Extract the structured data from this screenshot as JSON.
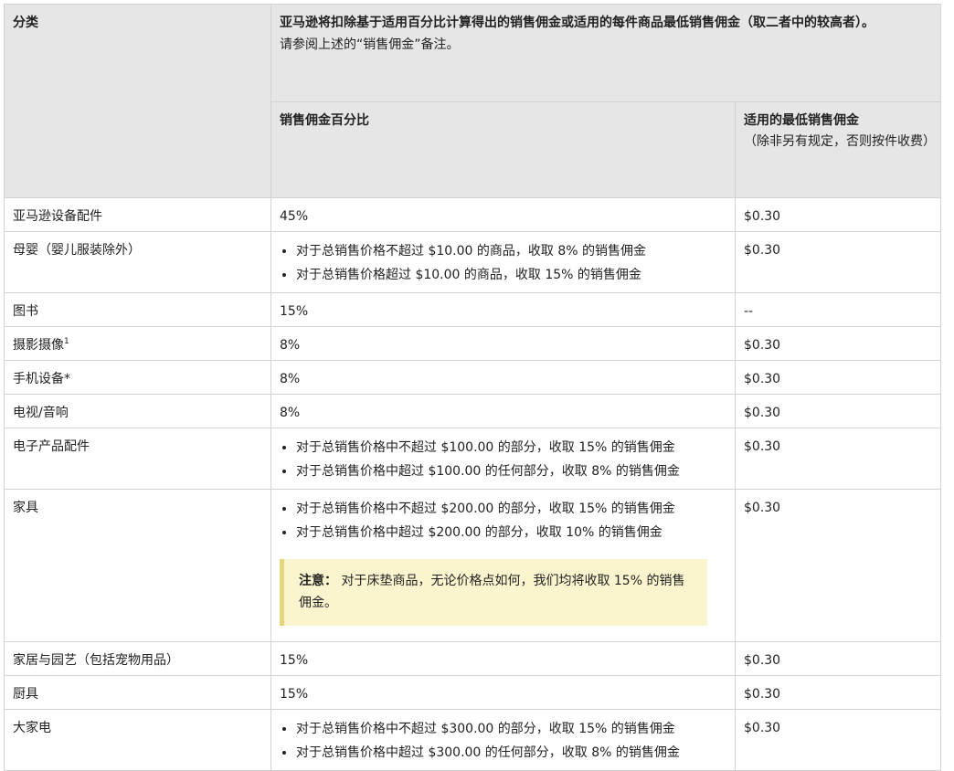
{
  "header": {
    "category_label": "分类",
    "intro_bold": "亚马逊将扣除基于适用百分比计算得出的销售佣金或适用的每件商品最低销售佣金（取二者中的较高者）。",
    "intro_note": "请参阅上述的“销售佣金”备注。",
    "percent_label": "销售佣金百分比",
    "min_label": "适用的最低销售佣金",
    "min_desc": "（除非另有规定，否则按件收费）"
  },
  "rows": [
    {
      "category": "亚马逊设备配件",
      "percent": "45%",
      "min": "$0.30"
    },
    {
      "category": "母婴（婴儿服装除外）",
      "percent_items": [
        "对于总销售价格不超过 $10.00 的商品，收取 8% 的销售佣金",
        "对于总销售价格超过 $10.00 的商品，收取 15% 的销售佣金"
      ],
      "min": "$0.30"
    },
    {
      "category": "图书",
      "percent": "15%",
      "min": "--"
    },
    {
      "category": "摄影摄像",
      "sup": "1",
      "percent": "8%",
      "min": "$0.30"
    },
    {
      "category": "手机设备*",
      "percent": "8%",
      "min": "$0.30"
    },
    {
      "category": "电视/音响",
      "percent": "8%",
      "min": "$0.30"
    },
    {
      "category": "电子产品配件",
      "percent_items": [
        "对于总销售价格中不超过 $100.00 的部分，收取 15% 的销售佣金",
        "对于总销售价格中超过 $100.00 的任何部分，收取 8% 的销售佣金"
      ],
      "min": "$0.30"
    },
    {
      "category": "家具",
      "percent_items": [
        "对于总销售价格中不超过 $200.00 的部分，收取 15% 的销售佣金",
        "对于总销售价格中超过 $200.00 的部分，收取 10% 的销售佣金"
      ],
      "note_label": "注意：",
      "note_text": "对于床垫商品，无论价格点如何，我们均将收取 15% 的销售佣金。",
      "min": "$0.30"
    },
    {
      "category": "家居与园艺（包括宠物用品）",
      "percent": "15%",
      "min": "$0.30"
    },
    {
      "category": "厨具",
      "percent": "15%",
      "min": "$0.30"
    },
    {
      "category": "大家电",
      "percent_items": [
        "对于总销售价格中不超过 $300.00 的部分，收取 15% 的销售佣金",
        "对于总销售价格中超过 $300.00 的任何部分，收取 8% 的销售佣金"
      ],
      "min": "$0.30"
    }
  ]
}
